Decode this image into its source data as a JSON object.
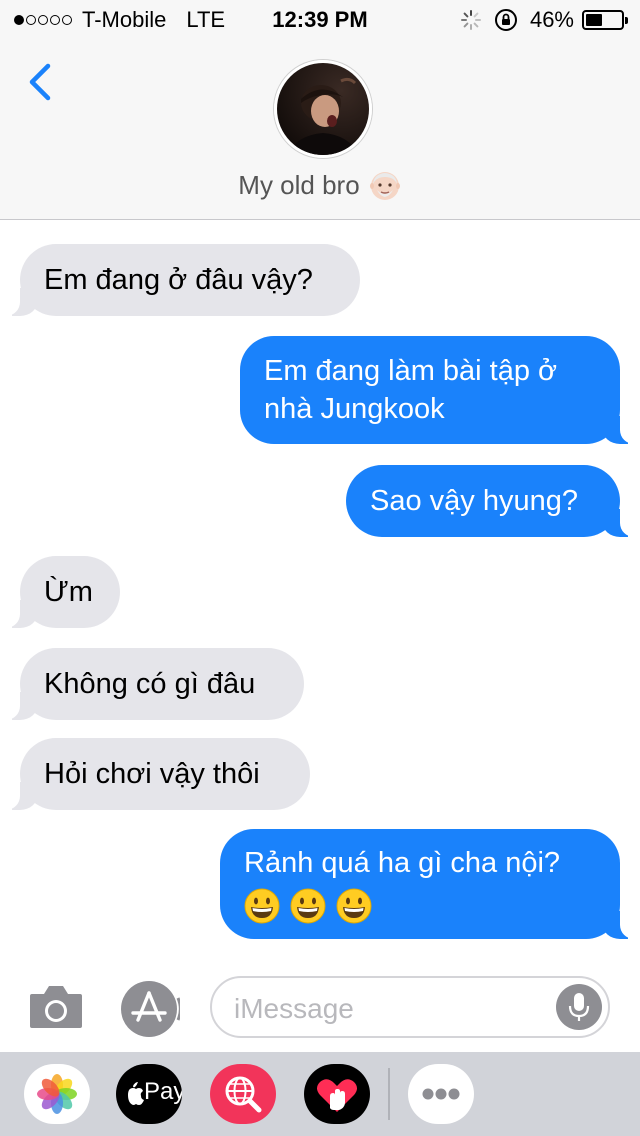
{
  "status_bar": {
    "carrier": "T-Mobile",
    "network": "LTE",
    "time": "12:39 PM",
    "battery_percent_text": "46%",
    "battery_level": 0.46,
    "signal_bars_filled": 1,
    "signal_bars_total": 5
  },
  "header": {
    "contact_name": "My old bro",
    "name_emoji_icon": "old-man-icon",
    "avatar_icon": "contact-photo"
  },
  "messages": [
    {
      "direction": "received",
      "text": "Em đang ở đâu vậy?"
    },
    {
      "direction": "sent",
      "lines": [
        "Em đang làm bài tập ở",
        "nhà Jungkook"
      ]
    },
    {
      "direction": "sent",
      "text": "Sao vậy hyung?"
    },
    {
      "direction": "received",
      "text": "Ừm"
    },
    {
      "direction": "received",
      "text": "Không có gì đâu"
    },
    {
      "direction": "received",
      "text": "Hỏi chơi vậy thôi"
    },
    {
      "direction": "sent",
      "text": "Rảnh quá ha gì cha nội?",
      "emoji": [
        "grinning-face-icon",
        "grinning-face-icon",
        "grinning-face-icon"
      ]
    }
  ],
  "input_bar": {
    "placeholder": "iMessage"
  },
  "app_drawer": {
    "apps": [
      {
        "name": "photos",
        "icon": "photos-icon"
      },
      {
        "name": "apple-pay",
        "icon": "apple-pay-icon",
        "label": "Pay"
      },
      {
        "name": "web-search",
        "icon": "globe-search-icon"
      },
      {
        "name": "digital-touch",
        "icon": "heart-hand-icon"
      },
      {
        "name": "more",
        "icon": "more-dots-icon"
      }
    ]
  },
  "colors": {
    "sent_bubble": "#1a82fb",
    "received_bubble": "#e5e5ea",
    "accent": "#1a82fb",
    "header_bg": "#f7f7f7",
    "drawer_bg": "#d1d3d9"
  }
}
